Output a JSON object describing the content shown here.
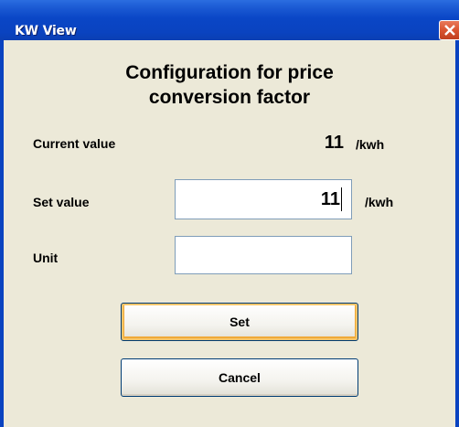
{
  "window": {
    "title": "KW View",
    "close_icon": "close-icon"
  },
  "dialog": {
    "heading_line1": "Configuration for price",
    "heading_line2": "conversion factor",
    "current_value": {
      "label": "Current value",
      "value": "11",
      "unit": "/kwh"
    },
    "set_value": {
      "label": "Set value",
      "input_value": "11",
      "unit": "/kwh"
    },
    "unit_field": {
      "label": "Unit",
      "input_value": ""
    },
    "buttons": {
      "set_label": "Set",
      "cancel_label": "Cancel"
    }
  },
  "colors": {
    "titlebar": "#0a43c0",
    "dialog_background": "#ece9d8",
    "close_button": "#d95430",
    "default_button_highlight": "#f5c56a"
  }
}
